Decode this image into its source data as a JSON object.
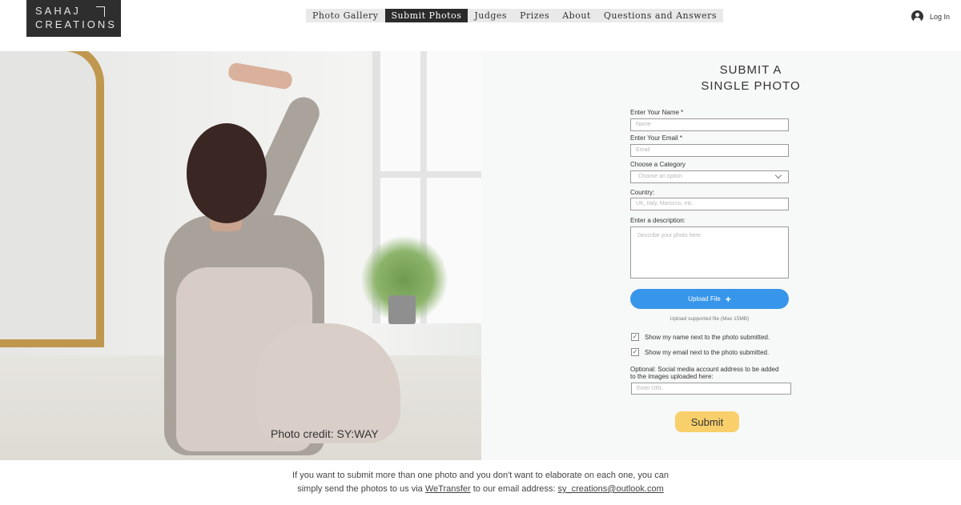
{
  "header": {
    "logo": {
      "line1": "SAHAJ",
      "line2": "CREATIONS"
    },
    "nav": [
      {
        "label": "Photo Gallery",
        "active": false
      },
      {
        "label": "Submit Photos",
        "active": true
      },
      {
        "label": "Judges",
        "active": false
      },
      {
        "label": "Prizes",
        "active": false
      },
      {
        "label": "About",
        "active": false
      },
      {
        "label": "Questions and Answers",
        "active": false
      }
    ],
    "login_label": "Log In"
  },
  "photo": {
    "credit_prefix": "Photo credit: ",
    "credit_name": "SY:WAY"
  },
  "form": {
    "title_line1": "SUBMIT A",
    "title_line2": "SINGLE PHOTO",
    "name_label": "Enter Your Name *",
    "name_placeholder": "Name",
    "email_label": "Enter Your Email *",
    "email_placeholder": "Email",
    "category_label": "Choose a Category",
    "category_value": "Choose an option",
    "country_label": "Country:",
    "country_placeholder": "UK, Italy, Marocco, etc.",
    "description_label": "Enter a description:",
    "description_placeholder": "Describe your photo here",
    "upload_label": "Upload File",
    "upload_icon": "+",
    "upload_note": "Upload supported file (Max 15MB)",
    "show_name": {
      "label": "Show my name next to the photo submitted.",
      "checked": true,
      "mark": "✓"
    },
    "show_email": {
      "label": "Show my email next to the photo submitted.",
      "checked": true,
      "mark": "✓"
    },
    "social_label": "Optional: Social media account address to be added to the images uploaded here:",
    "social_placeholder": "Enter URL",
    "submit_label": "Submit"
  },
  "footer": {
    "line1": "If you want to submit more than one photo and you don't want to elaborate on each one, you can",
    "line2_prefix": "simply send the photos to us via ",
    "wetransfer": "WeTransfer",
    "line2_middle": " to our email address: ",
    "email": "sy_creations@outlook.com"
  },
  "colors": {
    "accent_blue": "#3896ea",
    "submit_yellow": "#f8cf6b",
    "nav_active": "#2b2b2b"
  }
}
